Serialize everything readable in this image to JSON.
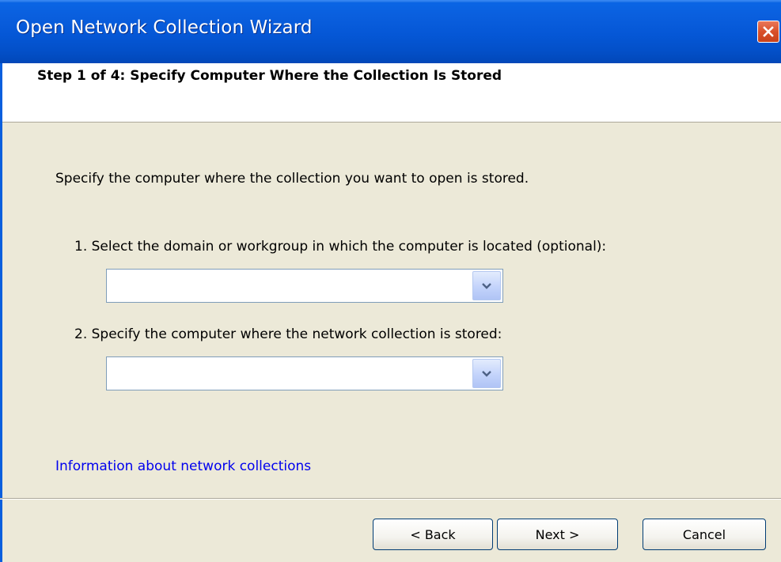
{
  "window": {
    "title": "Open Network Collection Wizard"
  },
  "header": {
    "step_title": "Step 1 of 4: Specify Computer Where the Collection Is Stored"
  },
  "body": {
    "intro": "Specify the computer where the collection you want to open is stored.",
    "domain_label": "1. Select the domain or workgroup in which the computer is located (optional):",
    "domain_value": "",
    "computer_label": "2. Specify the computer where the network collection is stored:",
    "computer_value": "",
    "info_link": "Information about network collections"
  },
  "buttons": {
    "back": "< Back",
    "next": "Next >",
    "cancel": "Cancel"
  },
  "icons": {
    "close": "close-icon",
    "dropdown": "chevron-down-icon"
  },
  "colors": {
    "titlebar": "#0a5fde",
    "dialog_bg": "#ece9d8",
    "close_button": "#d9502a",
    "link": "#0000ee"
  }
}
